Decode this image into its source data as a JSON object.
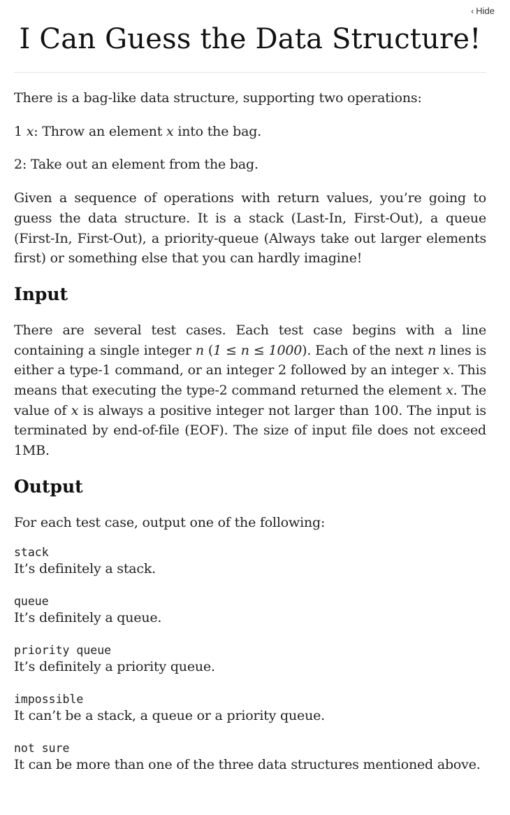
{
  "header": {
    "hide_label": "Hide"
  },
  "title": "I Can Guess the Data Structure!",
  "intro": {
    "p1": "There is a bag-like data structure, supporting two operations:",
    "op1": {
      "num": "1",
      "var": "x",
      "sep": ": Throw an element ",
      "var2": "x",
      "rest": " into the bag."
    },
    "op2": {
      "num": "2",
      "text": ": Take out an element from the bag."
    },
    "p2": "Given a sequence of operations with return values, you’re going to guess the data structure. It is a stack (Last-In, First-Out), a queue (First-In, First-Out), a priority-queue (Always take out larger elements first) or something else that you can hardly imagine!"
  },
  "input": {
    "heading": "Input",
    "t1": "There are several test cases. Each test case begins with a line containing a single integer ",
    "n1": "n",
    "t2": " (",
    "range": "1 ≤ n ≤ 1000",
    "t3": "). Each of the next ",
    "n2": "n",
    "t4": " lines is either a type-1 command, or an integer ",
    "two": "2",
    "t5": " followed by an integer ",
    "x1": "x",
    "t6": ". This means that executing the type-2 command returned the element ",
    "x2": "x",
    "t7": ". The value of ",
    "x3": "x",
    "t8": " is always a positive integer not larger than ",
    "hundred": "100",
    "t9": ". The input is terminated by end-of-file (EOF). The size of input file does not exceed 1MB."
  },
  "output": {
    "heading": "Output",
    "intro": "For each test case, output one of the following:",
    "items": [
      {
        "code": "stack",
        "desc": "It’s definitely a stack."
      },
      {
        "code": "queue",
        "desc": "It’s definitely a queue."
      },
      {
        "code": "priority queue",
        "desc": "It’s definitely a priority queue."
      },
      {
        "code": "impossible",
        "desc": "It can’t be a stack, a queue or a priority queue."
      },
      {
        "code": "not sure",
        "desc": "It can be more than one of the three data structures mentioned above."
      }
    ]
  }
}
